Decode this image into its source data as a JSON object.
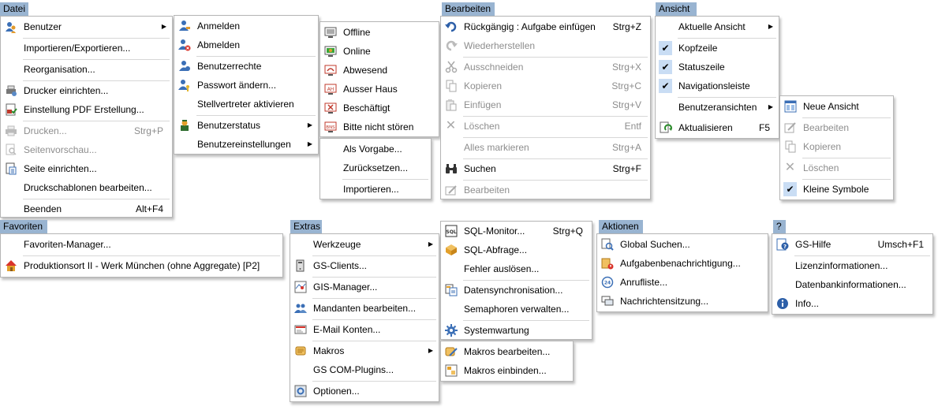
{
  "headers": {
    "datei": "Datei",
    "bearbeiten": "Bearbeiten",
    "ansicht": "Ansicht",
    "favoriten": "Favoriten",
    "extras": "Extras",
    "aktionen": "Aktionen",
    "hilfe": "?"
  },
  "datei": {
    "benutzer": "Benutzer",
    "importieren": "Importieren/Exportieren...",
    "reorganisation": "Reorganisation...",
    "drucker": "Drucker einrichten...",
    "pdf": "Einstellung PDF Erstellung...",
    "drucken": "Drucken...",
    "drucken_sc": "Strg+P",
    "seitenvorschau": "Seitenvorschau...",
    "seite": "Seite einrichten...",
    "druckschablonen": "Druckschablonen bearbeiten...",
    "beenden": "Beenden",
    "beenden_sc": "Alt+F4"
  },
  "benutzer": {
    "anmelden": "Anmelden",
    "abmelden": "Abmelden",
    "rechte": "Benutzerrechte",
    "passwort": "Passwort ändern...",
    "stellvertreter": "Stellvertreter aktivieren",
    "status": "Benutzerstatus",
    "einstellungen": "Benutzereinstellungen"
  },
  "status": {
    "offline": "Offline",
    "online": "Online",
    "abwesend": "Abwesend",
    "ausser_haus": "Ausser Haus",
    "beschaeftigt": "Beschäftigt",
    "nicht_stoeren": "Bitte nicht stören",
    "icon_ah": "AH",
    "icon_bns": "BNS"
  },
  "einstellungen": {
    "vorgabe": "Als Vorgabe...",
    "zuruecksetzen": "Zurücksetzen...",
    "importieren": "Importieren..."
  },
  "bearbeiten": {
    "rueckgaengig": "Rückgängig : Aufgabe einfügen",
    "rueckgaengig_sc": "Strg+Z",
    "wiederherstellen": "Wiederherstellen",
    "ausschneiden": "Ausschneiden",
    "ausschneiden_sc": "Strg+X",
    "kopieren": "Kopieren",
    "kopieren_sc": "Strg+C",
    "einfuegen": "Einfügen",
    "einfuegen_sc": "Strg+V",
    "loeschen": "Löschen",
    "loeschen_sc": "Entf",
    "alles": "Alles markieren",
    "alles_sc": "Strg+A",
    "suchen": "Suchen",
    "suchen_sc": "Strg+F",
    "bearbeiten": "Bearbeiten"
  },
  "ansicht": {
    "aktuelle": "Aktuelle Ansicht",
    "kopfzeile": "Kopfzeile",
    "statuszeile": "Statuszeile",
    "navigation": "Navigationsleiste",
    "benutzeransichten": "Benutzeransichten",
    "aktualisieren": "Aktualisieren",
    "aktualisieren_sc": "F5"
  },
  "benutzeransichten": {
    "neue": "Neue Ansicht",
    "bearbeiten": "Bearbeiten",
    "kopieren": "Kopieren",
    "loeschen": "Löschen",
    "kleine": "Kleine Symbole"
  },
  "favoriten": {
    "manager": "Favoriten-Manager...",
    "produktionsort": "Produktionsort II - Werk München (ohne Aggregate) [P2]"
  },
  "extras": {
    "werkzeuge": "Werkzeuge",
    "gs_clients": "GS-Clients...",
    "gis": "GIS-Manager...",
    "mandanten": "Mandanten bearbeiten...",
    "email": "E-Mail Konten...",
    "makros": "Makros",
    "com": "GS COM-Plugins...",
    "optionen": "Optionen..."
  },
  "werkzeuge": {
    "sql_monitor": "SQL-Monitor...",
    "sql_monitor_sc": "Strg+Q",
    "sql_abfrage": "SQL-Abfrage...",
    "fehler": "Fehler auslösen...",
    "datensync": "Datensynchronisation...",
    "semaphoren": "Semaphoren verwalten...",
    "systemwartung": "Systemwartung",
    "icon_sql": "SQL"
  },
  "makros": {
    "bearbeiten": "Makros bearbeiten...",
    "einbinden": "Makros einbinden..."
  },
  "aktionen": {
    "global": "Global Suchen...",
    "aufgaben": "Aufgabenbenachrichtigung...",
    "anrufliste": "Anrufliste...",
    "nachrichten": "Nachrichtensitzung...",
    "icon_24": "24"
  },
  "hilfe": {
    "gs_hilfe": "GS-Hilfe",
    "gs_hilfe_sc": "Umsch+F1",
    "lizenz": "Lizenzinformationen...",
    "datenbank": "Datenbankinformationen...",
    "info": "Info..."
  },
  "colors": {
    "header_bg": "#99b4d1",
    "check_bg": "#c9ddf4",
    "disabled_text": "#8d8d8d",
    "menu_border": "#b5b5b5"
  }
}
